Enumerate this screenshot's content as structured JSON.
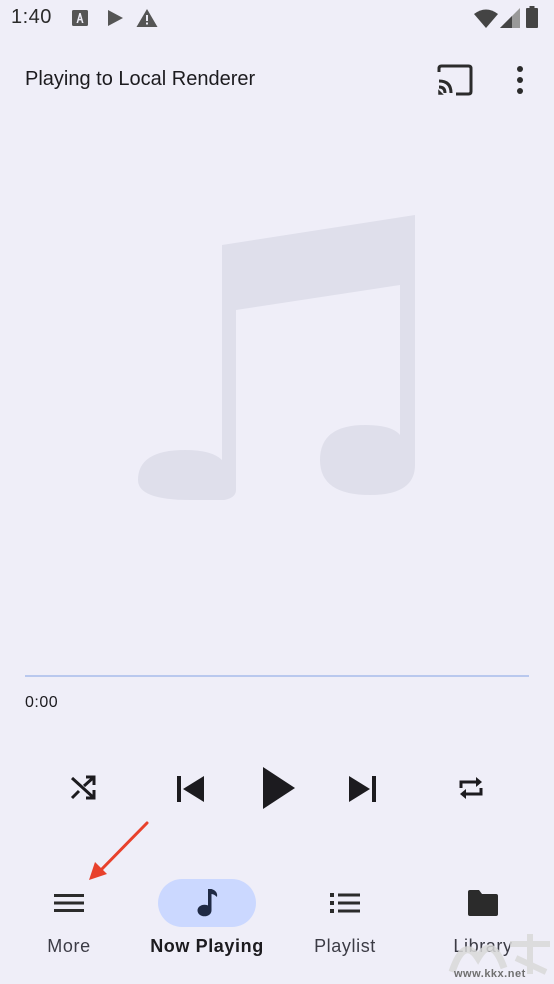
{
  "status_bar": {
    "time": "1:40",
    "icons": [
      "font-download-icon",
      "play-store-icon",
      "warning-icon",
      "wifi-icon",
      "signal-icon",
      "battery-icon"
    ]
  },
  "top_bar": {
    "title": "Playing to Local Renderer",
    "icons": [
      "cast-icon",
      "more-vertical-icon"
    ]
  },
  "album_art": {
    "icon": "music-note-icon"
  },
  "player": {
    "position": "0:00",
    "progress": 0,
    "controls": [
      "shuffle-icon",
      "skip-previous-icon",
      "play-icon",
      "skip-next-icon",
      "repeat-icon"
    ]
  },
  "bottom_nav": {
    "items": [
      {
        "label": "More",
        "icon": "menu-icon",
        "active": false
      },
      {
        "label": "Now Playing",
        "icon": "music-note-icon",
        "active": true
      },
      {
        "label": "Playlist",
        "icon": "list-icon",
        "active": false
      },
      {
        "label": "Library",
        "icon": "folder-icon",
        "active": false
      }
    ]
  },
  "watermark": {
    "text": "www.kkx.net"
  },
  "colors": {
    "background": "#efeef8",
    "active_indicator": "#cbd8ff",
    "progress_track": "#b9c8ee",
    "annotation_arrow": "#e8412c",
    "album_art_placeholder": "#dfdfeb"
  }
}
